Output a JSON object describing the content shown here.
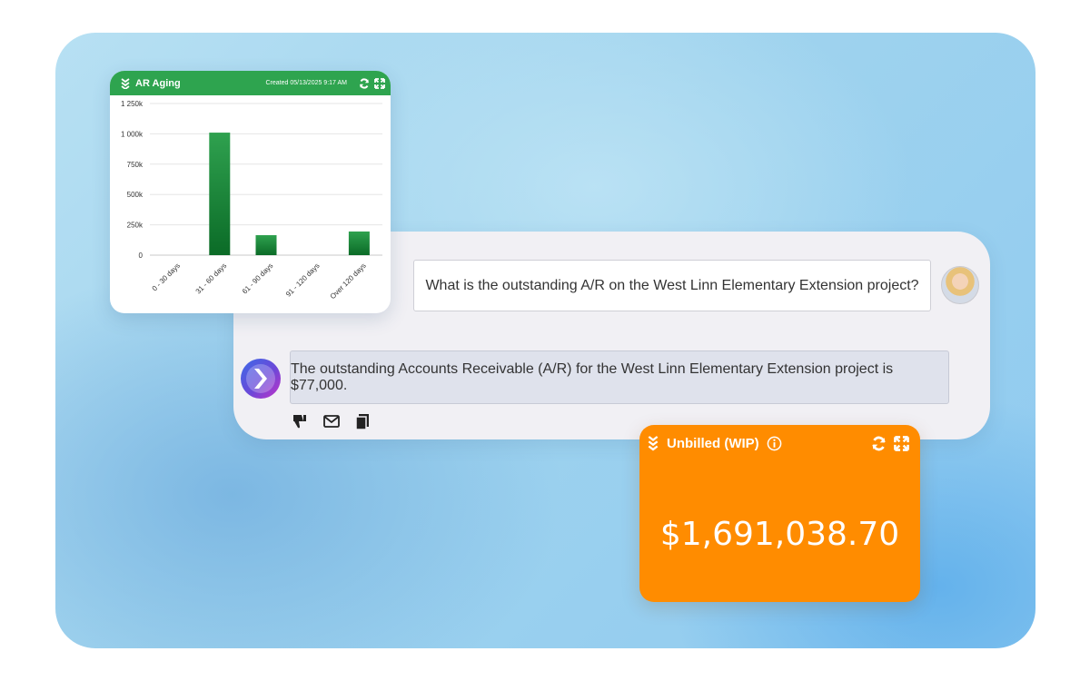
{
  "ar_card": {
    "title": "AR Aging",
    "created": "Created 05/13/2025 9:17 AM",
    "icons": [
      "collapse-chevrons-icon",
      "refresh-icon",
      "expand-icon"
    ],
    "header_color": "#2ea44f",
    "bar_color": "#1a8a3a"
  },
  "chart_data": {
    "type": "bar",
    "title": "",
    "categories": [
      "0 - 30 days",
      "31 - 60 days",
      "61 - 90 days",
      "91 - 120 days",
      "Over 120 days"
    ],
    "values": [
      0,
      1010000,
      165000,
      0,
      195000
    ],
    "ytick_labels": [
      "0",
      "250k",
      "500k",
      "750k",
      "1 000k",
      "1 250k"
    ],
    "ytick_values": [
      0,
      250000,
      500000,
      750000,
      1000000,
      1250000
    ],
    "ylim": [
      0,
      1250000
    ],
    "grid": true,
    "legend": "none"
  },
  "chat": {
    "question": "What is the outstanding A/R on the West Linn Elementary Extension project?",
    "answer": "The outstanding Accounts Receivable (A/R) for the West Linn Elementary Extension project is $77,000.",
    "actions": [
      "thumbs-down-icon",
      "email-icon",
      "copy-icon"
    ]
  },
  "wip_card": {
    "title": "Unbilled (WIP)",
    "amount": "$1,691,038.70",
    "color": "#ff8c00",
    "icons": [
      "collapse-chevrons-icon",
      "info-icon",
      "refresh-icon",
      "expand-icon"
    ]
  }
}
